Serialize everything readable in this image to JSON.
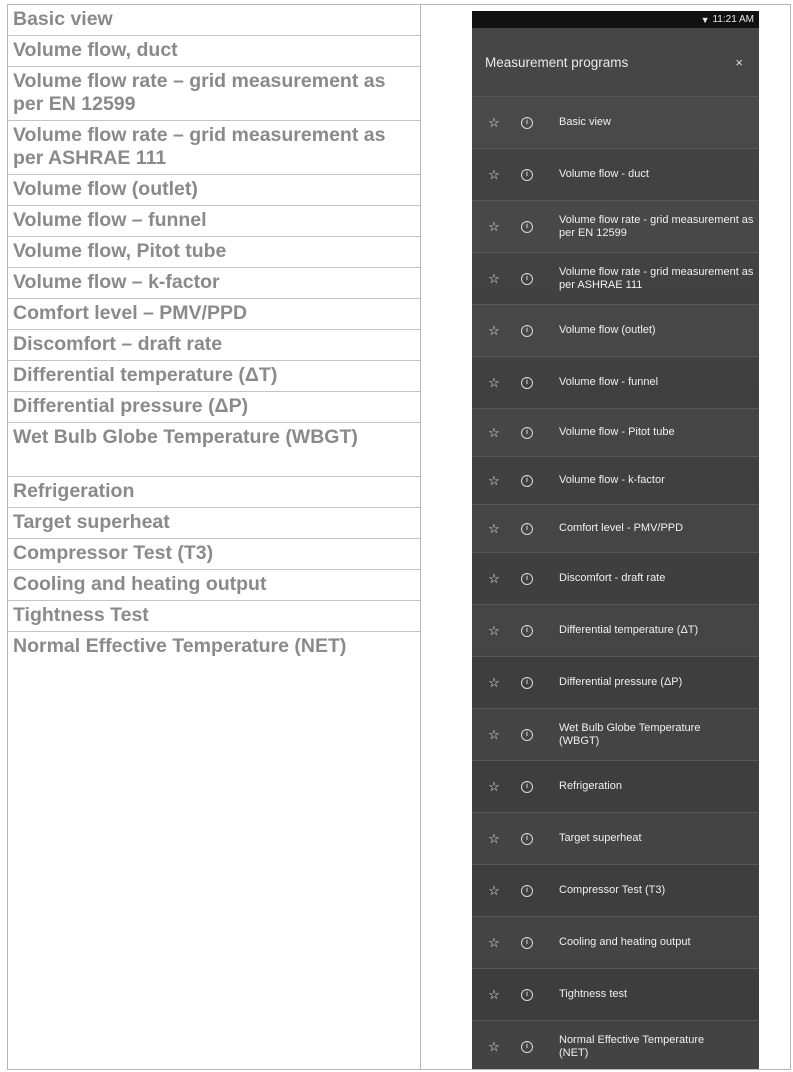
{
  "left_column": {
    "rows": [
      "Basic view",
      "Volume flow, duct",
      "Volume flow rate – grid measurement as per EN 12599",
      "Volume flow rate – grid measurement as per ASHRAE 111",
      "Volume flow (outlet)",
      "Volume flow – funnel",
      "Volume flow, Pitot tube",
      "Volume flow – k-factor",
      "Comfort level – PMV/PPD",
      "Discomfort – draft rate",
      "Differential temperature (ΔT)",
      "Differential pressure (ΔP)",
      "Wet Bulb Globe Temperature (WBGT)",
      "Refrigeration",
      "Target superheat",
      "Compressor Test (T3)",
      "Cooling and heating output",
      "Tightness Test",
      "Normal Effective Temperature (NET)"
    ]
  },
  "phone": {
    "status_time": "11:21 AM",
    "status_icon": "wifi-icon",
    "title": "Measurement programs",
    "close_symbol": "×",
    "star_symbol": "☆",
    "info_symbol": "i",
    "items": [
      "Basic view",
      "Volume flow - duct",
      "Volume flow rate - grid measurement as per EN 12599",
      "Volume flow rate - grid measurement as per ASHRAE 111",
      "Volume flow (outlet)",
      "Volume flow - funnel",
      "Volume flow - Pitot tube",
      "Volume flow - k-factor",
      "Comfort level - PMV/PPD",
      "Discomfort - draft rate",
      "Differential temperature (ΔT)",
      "Differential pressure (ΔP)",
      "Wet Bulb Globe Temperature (WBGT)",
      "Refrigeration",
      "Target superheat",
      "Compressor Test (T3)",
      "Cooling and heating output",
      "Tightness test",
      "Normal Effective Temperature (NET)"
    ]
  },
  "colors": {
    "doc_text": "#8a8a8a",
    "phone_bg": "#444444",
    "status_bar": "#111111"
  }
}
